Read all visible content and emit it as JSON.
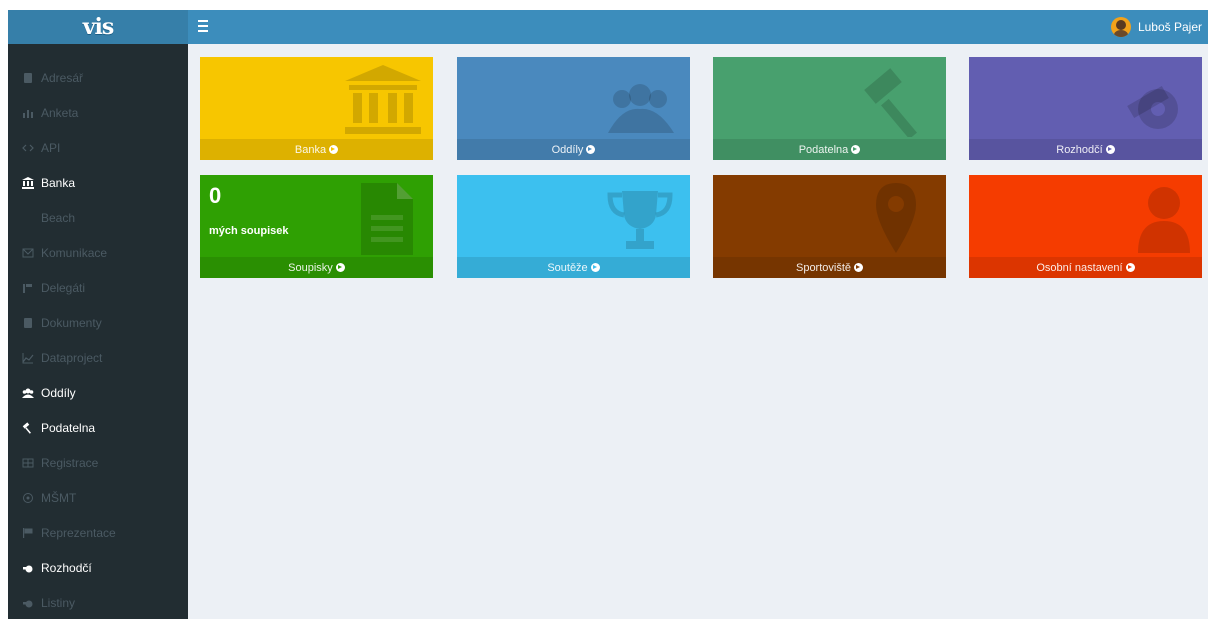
{
  "app": {
    "logo_text": "vis"
  },
  "topbar": {
    "user_name": "Luboš Pajer"
  },
  "sidebar": {
    "items": [
      {
        "label": "Adresář",
        "icon": "book-icon",
        "active": false
      },
      {
        "label": "Anketa",
        "icon": "bar-chart-icon",
        "active": false
      },
      {
        "label": "API",
        "icon": "code-icon",
        "active": false
      },
      {
        "label": "Banka",
        "icon": "bank-icon",
        "active": true
      },
      {
        "label": "Beach",
        "icon": "",
        "active": false
      },
      {
        "label": "Komunikace",
        "icon": "envelope-icon",
        "active": false
      },
      {
        "label": "Delegáti",
        "icon": "delegate-icon",
        "active": false
      },
      {
        "label": "Dokumenty",
        "icon": "book-icon",
        "active": false
      },
      {
        "label": "Dataproject",
        "icon": "line-chart-icon",
        "active": false
      },
      {
        "label": "Oddíly",
        "icon": "users-icon",
        "active": true
      },
      {
        "label": "Podatelna",
        "icon": "gavel-icon",
        "active": true
      },
      {
        "label": "Registrace",
        "icon": "table-icon",
        "active": false
      },
      {
        "label": "MŠMT",
        "icon": "circle-icon",
        "active": false
      },
      {
        "label": "Reprezentace",
        "icon": "flag-icon",
        "active": false
      },
      {
        "label": "Rozhodčí",
        "icon": "whistle-icon",
        "active": true
      },
      {
        "label": "Listiny",
        "icon": "whistle-icon",
        "active": false
      }
    ]
  },
  "tiles": [
    {
      "label": "Banka",
      "color": "#f7c600",
      "icon": "bank-icon"
    },
    {
      "label": "Oddíly",
      "color": "#4a89be",
      "icon": "users-icon"
    },
    {
      "label": "Podatelna",
      "color": "#48a06e",
      "icon": "gavel-icon"
    },
    {
      "label": "Rozhodčí",
      "color": "#625eb1",
      "icon": "whistle-icon"
    },
    {
      "label": "Soupisky",
      "color": "#2fa003",
      "icon": "document-icon",
      "count": "0",
      "count_label": "mých soupisek"
    },
    {
      "label": "Soutěže",
      "color": "#3cc0ef",
      "icon": "trophy-icon"
    },
    {
      "label": "Sportoviště",
      "color": "#843b00",
      "icon": "map-marker-icon"
    },
    {
      "label": "Osobní nastavení",
      "color": "#f53c00",
      "icon": "user-icon"
    }
  ]
}
